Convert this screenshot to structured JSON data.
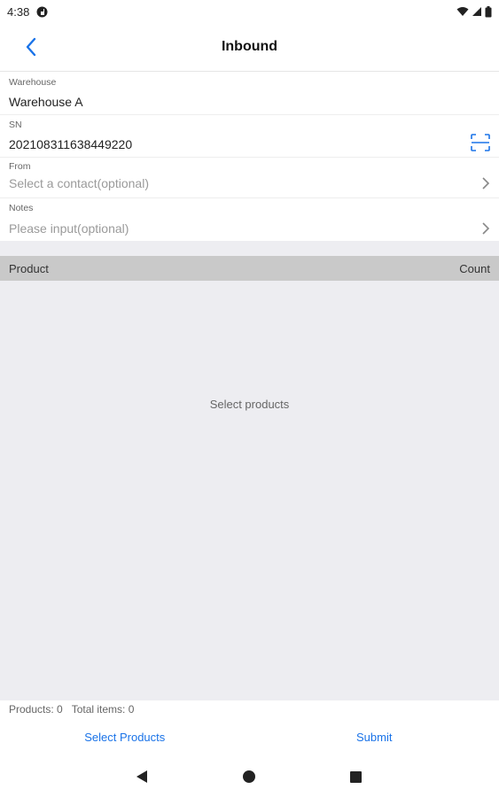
{
  "status_bar": {
    "time": "4:38",
    "icons_left": [
      "notification-icon"
    ],
    "icons_right": [
      "wifi-icon",
      "signal-icon",
      "battery-icon"
    ]
  },
  "app_bar": {
    "title": "Inbound",
    "back_icon": "chevron-left-icon"
  },
  "form": {
    "warehouse": {
      "label": "Warehouse",
      "value": "Warehouse A"
    },
    "sn": {
      "label": "SN",
      "value": "202108311638449220",
      "action_icon": "scan-icon"
    },
    "from": {
      "label": "From",
      "placeholder": "Select a contact(optional)",
      "action_icon": "chevron-right-icon"
    },
    "notes": {
      "label": "Notes",
      "placeholder": "Please input(optional)",
      "action_icon": "chevron-right-icon"
    }
  },
  "table": {
    "columns": [
      "Product",
      "Count"
    ],
    "empty_text": "Select products"
  },
  "summary": {
    "products": "Products: 0",
    "total_items": "Total items: 0"
  },
  "actions": {
    "select_products": "Select Products",
    "submit": "Submit"
  },
  "nav_bar": {
    "back": "back-icon",
    "home": "home-icon",
    "recents": "recents-icon"
  },
  "colors": {
    "accent": "#1a73e8",
    "table_header_bg": "#c9c9c9",
    "panel_bg": "#ededf1"
  }
}
